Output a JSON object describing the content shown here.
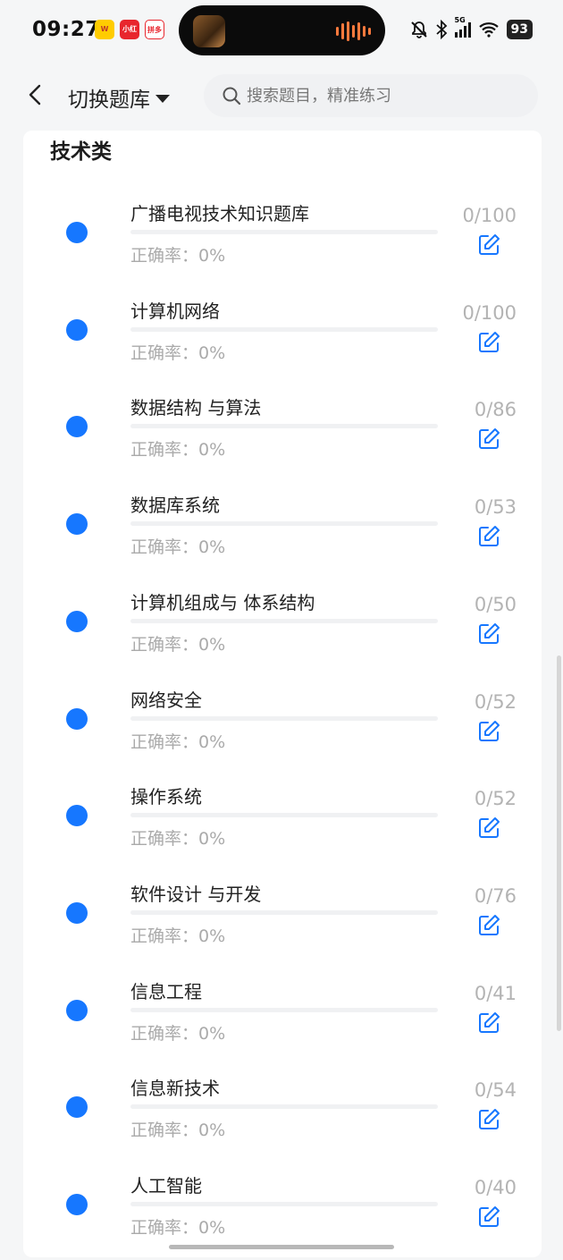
{
  "status_bar": {
    "time": "09:27",
    "app_icon_1": "W",
    "app_icon_2": "小红书",
    "app_icon_3": "拼多多",
    "network": "5G",
    "battery": "93",
    "icons": [
      "mute-bell-icon",
      "bluetooth-icon",
      "signal-icon",
      "wifi-icon",
      "battery-icon"
    ]
  },
  "nav": {
    "title": "切换题库",
    "search_placeholder": "搜索题目，精准练习"
  },
  "section": {
    "title": "技术类",
    "rate_label": "正确率：",
    "items": [
      {
        "name": "广播电视技术知识题库",
        "rate": "0%",
        "count": "0/100",
        "progress": 0
      },
      {
        "name": "计算机网络",
        "rate": "0%",
        "count": "0/100",
        "progress": 0
      },
      {
        "name": "数据结构 与算法",
        "rate": "0%",
        "count": "0/86",
        "progress": 0
      },
      {
        "name": "数据库系统",
        "rate": "0%",
        "count": "0/53",
        "progress": 0
      },
      {
        "name": "计算机组成与 体系结构",
        "rate": "0%",
        "count": "0/50",
        "progress": 0
      },
      {
        "name": "网络安全",
        "rate": "0%",
        "count": "0/52",
        "progress": 0
      },
      {
        "name": "操作系统",
        "rate": "0%",
        "count": "0/52",
        "progress": 0
      },
      {
        "name": "软件设计 与开发",
        "rate": "0%",
        "count": "0/76",
        "progress": 0
      },
      {
        "name": "信息工程",
        "rate": "0%",
        "count": "0/41",
        "progress": 0
      },
      {
        "name": "信息新技术",
        "rate": "0%",
        "count": "0/54",
        "progress": 0
      },
      {
        "name": "人工智能",
        "rate": "0%",
        "count": "0/40",
        "progress": 0
      }
    ]
  },
  "colors": {
    "accent": "#1677ff",
    "muted_text": "#aaaaaa"
  }
}
